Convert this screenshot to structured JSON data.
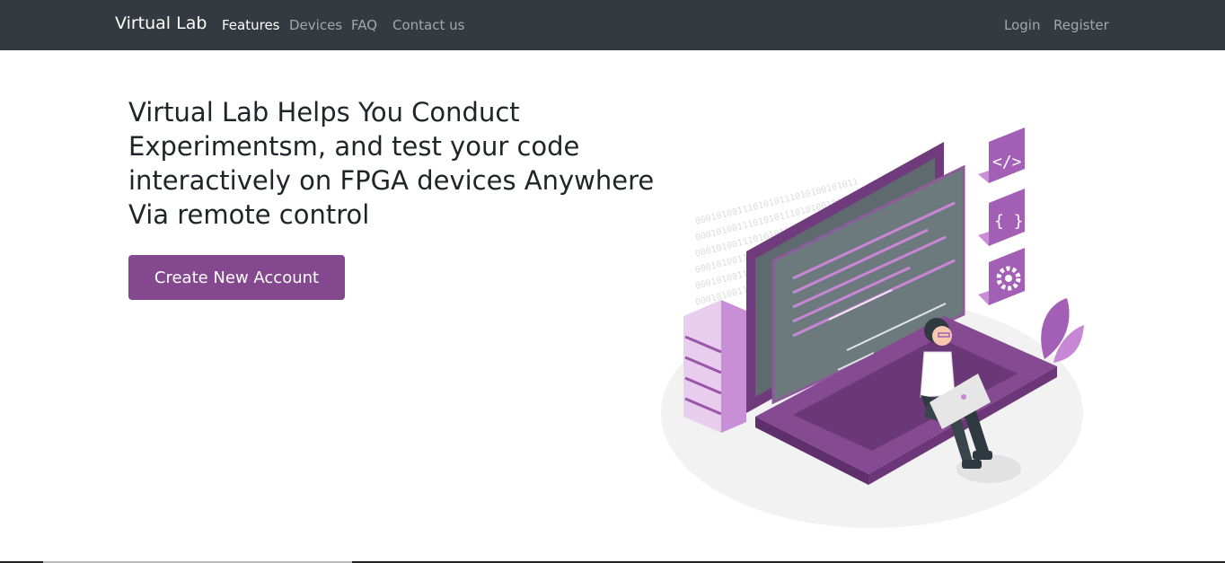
{
  "navbar": {
    "brand": "Virtual Lab",
    "links": [
      {
        "label": "Features",
        "active": true
      },
      {
        "label": "Devices",
        "active": false
      },
      {
        "label": "FAQ",
        "active": false
      },
      {
        "label": "Contact us",
        "active": false
      }
    ],
    "auth": {
      "login": "Login",
      "register": "Register"
    }
  },
  "hero": {
    "title": "Virtual Lab Helps You Conduct Experimentsm, and test your code interactively on FPGA devices Anywhere Via remote control",
    "cta_label": "Create New Account"
  },
  "illustration": {
    "code_tag_glyph": "</>",
    "braces_glyph": "{ }",
    "binary_text": "0001010011101010111010100101011"
  },
  "colors": {
    "navbar_bg": "#343a40",
    "accent": "#84488e",
    "illustration_purple": "#a35fb5"
  }
}
